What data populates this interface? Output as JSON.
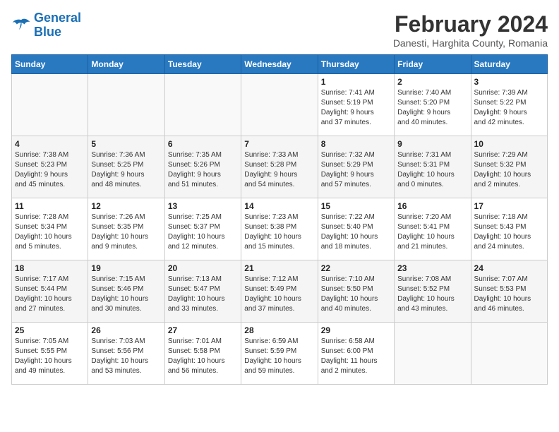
{
  "header": {
    "logo_line1": "General",
    "logo_line2": "Blue",
    "month": "February 2024",
    "location": "Danesti, Harghita County, Romania"
  },
  "columns": [
    "Sunday",
    "Monday",
    "Tuesday",
    "Wednesday",
    "Thursday",
    "Friday",
    "Saturday"
  ],
  "weeks": [
    [
      {
        "day": "",
        "info": ""
      },
      {
        "day": "",
        "info": ""
      },
      {
        "day": "",
        "info": ""
      },
      {
        "day": "",
        "info": ""
      },
      {
        "day": "1",
        "info": "Sunrise: 7:41 AM\nSunset: 5:19 PM\nDaylight: 9 hours\nand 37 minutes."
      },
      {
        "day": "2",
        "info": "Sunrise: 7:40 AM\nSunset: 5:20 PM\nDaylight: 9 hours\nand 40 minutes."
      },
      {
        "day": "3",
        "info": "Sunrise: 7:39 AM\nSunset: 5:22 PM\nDaylight: 9 hours\nand 42 minutes."
      }
    ],
    [
      {
        "day": "4",
        "info": "Sunrise: 7:38 AM\nSunset: 5:23 PM\nDaylight: 9 hours\nand 45 minutes."
      },
      {
        "day": "5",
        "info": "Sunrise: 7:36 AM\nSunset: 5:25 PM\nDaylight: 9 hours\nand 48 minutes."
      },
      {
        "day": "6",
        "info": "Sunrise: 7:35 AM\nSunset: 5:26 PM\nDaylight: 9 hours\nand 51 minutes."
      },
      {
        "day": "7",
        "info": "Sunrise: 7:33 AM\nSunset: 5:28 PM\nDaylight: 9 hours\nand 54 minutes."
      },
      {
        "day": "8",
        "info": "Sunrise: 7:32 AM\nSunset: 5:29 PM\nDaylight: 9 hours\nand 57 minutes."
      },
      {
        "day": "9",
        "info": "Sunrise: 7:31 AM\nSunset: 5:31 PM\nDaylight: 10 hours\nand 0 minutes."
      },
      {
        "day": "10",
        "info": "Sunrise: 7:29 AM\nSunset: 5:32 PM\nDaylight: 10 hours\nand 2 minutes."
      }
    ],
    [
      {
        "day": "11",
        "info": "Sunrise: 7:28 AM\nSunset: 5:34 PM\nDaylight: 10 hours\nand 5 minutes."
      },
      {
        "day": "12",
        "info": "Sunrise: 7:26 AM\nSunset: 5:35 PM\nDaylight: 10 hours\nand 9 minutes."
      },
      {
        "day": "13",
        "info": "Sunrise: 7:25 AM\nSunset: 5:37 PM\nDaylight: 10 hours\nand 12 minutes."
      },
      {
        "day": "14",
        "info": "Sunrise: 7:23 AM\nSunset: 5:38 PM\nDaylight: 10 hours\nand 15 minutes."
      },
      {
        "day": "15",
        "info": "Sunrise: 7:22 AM\nSunset: 5:40 PM\nDaylight: 10 hours\nand 18 minutes."
      },
      {
        "day": "16",
        "info": "Sunrise: 7:20 AM\nSunset: 5:41 PM\nDaylight: 10 hours\nand 21 minutes."
      },
      {
        "day": "17",
        "info": "Sunrise: 7:18 AM\nSunset: 5:43 PM\nDaylight: 10 hours\nand 24 minutes."
      }
    ],
    [
      {
        "day": "18",
        "info": "Sunrise: 7:17 AM\nSunset: 5:44 PM\nDaylight: 10 hours\nand 27 minutes."
      },
      {
        "day": "19",
        "info": "Sunrise: 7:15 AM\nSunset: 5:46 PM\nDaylight: 10 hours\nand 30 minutes."
      },
      {
        "day": "20",
        "info": "Sunrise: 7:13 AM\nSunset: 5:47 PM\nDaylight: 10 hours\nand 33 minutes."
      },
      {
        "day": "21",
        "info": "Sunrise: 7:12 AM\nSunset: 5:49 PM\nDaylight: 10 hours\nand 37 minutes."
      },
      {
        "day": "22",
        "info": "Sunrise: 7:10 AM\nSunset: 5:50 PM\nDaylight: 10 hours\nand 40 minutes."
      },
      {
        "day": "23",
        "info": "Sunrise: 7:08 AM\nSunset: 5:52 PM\nDaylight: 10 hours\nand 43 minutes."
      },
      {
        "day": "24",
        "info": "Sunrise: 7:07 AM\nSunset: 5:53 PM\nDaylight: 10 hours\nand 46 minutes."
      }
    ],
    [
      {
        "day": "25",
        "info": "Sunrise: 7:05 AM\nSunset: 5:55 PM\nDaylight: 10 hours\nand 49 minutes."
      },
      {
        "day": "26",
        "info": "Sunrise: 7:03 AM\nSunset: 5:56 PM\nDaylight: 10 hours\nand 53 minutes."
      },
      {
        "day": "27",
        "info": "Sunrise: 7:01 AM\nSunset: 5:58 PM\nDaylight: 10 hours\nand 56 minutes."
      },
      {
        "day": "28",
        "info": "Sunrise: 6:59 AM\nSunset: 5:59 PM\nDaylight: 10 hours\nand 59 minutes."
      },
      {
        "day": "29",
        "info": "Sunrise: 6:58 AM\nSunset: 6:00 PM\nDaylight: 11 hours\nand 2 minutes."
      },
      {
        "day": "",
        "info": ""
      },
      {
        "day": "",
        "info": ""
      }
    ]
  ]
}
